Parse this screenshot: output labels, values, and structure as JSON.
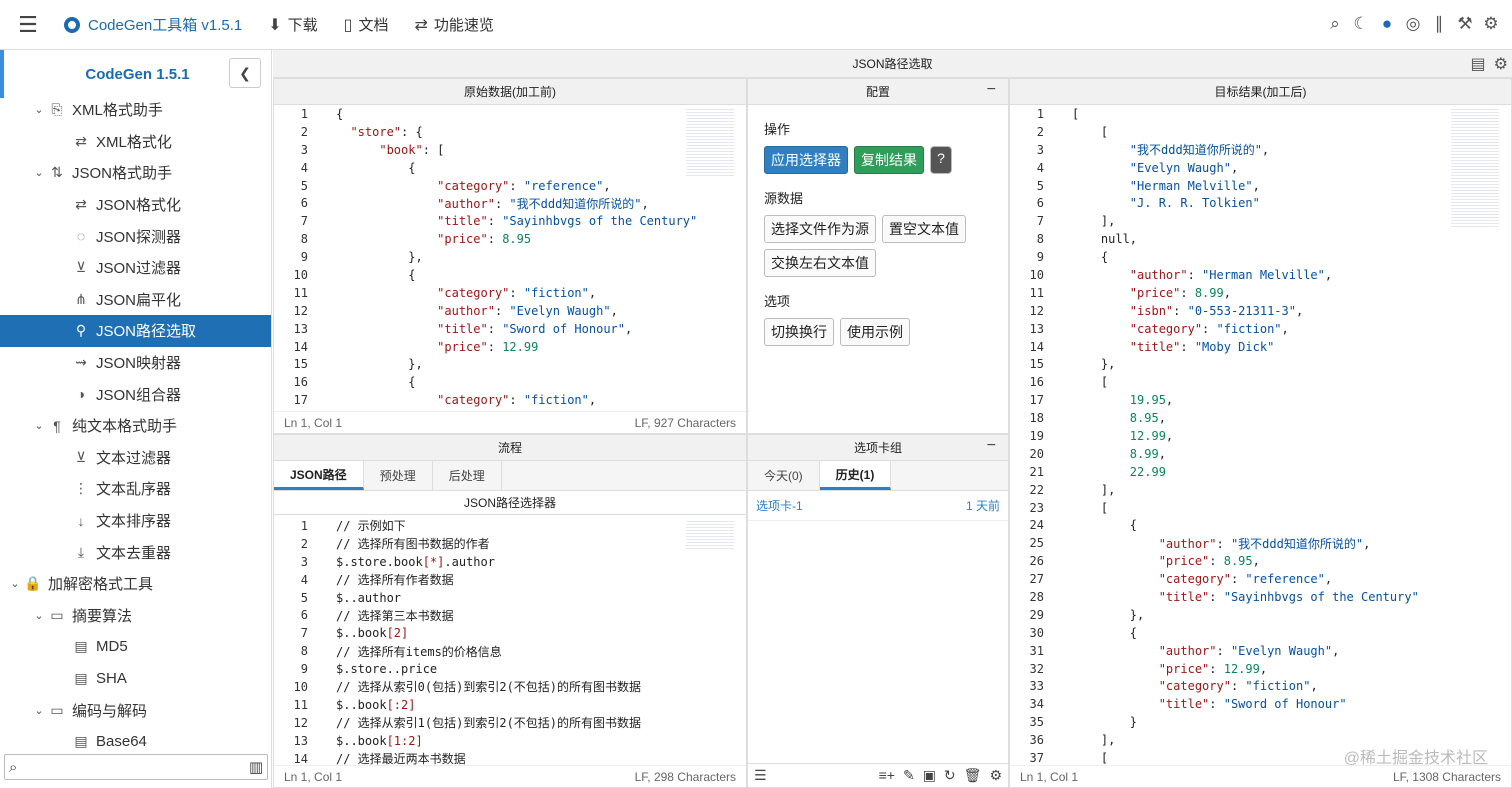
{
  "header": {
    "brand": "CodeGen工具箱 v1.5.1",
    "nav": [
      {
        "label": "下载",
        "icon": "download-icon"
      },
      {
        "label": "文档",
        "icon": "book-icon"
      },
      {
        "label": "功能速览",
        "icon": "swap-icon"
      }
    ]
  },
  "sidebar": {
    "title": "CodeGen 1.5.1",
    "items": [
      {
        "label": "XML格式助手",
        "level": 1,
        "arrow": "⌄"
      },
      {
        "label": "XML格式化",
        "level": 2
      },
      {
        "label": "JSON格式助手",
        "level": 1,
        "arrow": "⌄"
      },
      {
        "label": "JSON格式化",
        "level": 2
      },
      {
        "label": "JSON探测器",
        "level": 2
      },
      {
        "label": "JSON过滤器",
        "level": 2
      },
      {
        "label": "JSON扁平化",
        "level": 2
      },
      {
        "label": "JSON路径选取",
        "level": 2,
        "selected": true
      },
      {
        "label": "JSON映射器",
        "level": 2
      },
      {
        "label": "JSON组合器",
        "level": 2
      },
      {
        "label": "纯文本格式助手",
        "level": 1,
        "arrow": "⌄"
      },
      {
        "label": "文本过滤器",
        "level": 2
      },
      {
        "label": "文本乱序器",
        "level": 2
      },
      {
        "label": "文本排序器",
        "level": 2
      },
      {
        "label": "文本去重器",
        "level": 2
      },
      {
        "label": "加解密格式工具",
        "level": 0,
        "arrow": "⌄"
      },
      {
        "label": "摘要算法",
        "level": 1,
        "arrow": "⌄"
      },
      {
        "label": "MD5",
        "level": 2
      },
      {
        "label": "SHA",
        "level": 2
      },
      {
        "label": "编码与解码",
        "level": 1,
        "arrow": "⌄"
      },
      {
        "label": "Base64",
        "level": 2
      }
    ]
  },
  "main": {
    "title": "JSON路径选取",
    "source": {
      "title": "原始数据(加工前)",
      "status_left": "Ln 1, Col 1",
      "status_right": "LF, 927 Characters"
    },
    "config": {
      "title": "配置",
      "sections": [
        {
          "label": "操作"
        },
        {
          "label": "源数据"
        },
        {
          "label": "选项"
        }
      ],
      "buttons": {
        "apply": "应用选择器",
        "copy": "复制结果",
        "help": "?",
        "choose_file": "选择文件作为源",
        "clear": "置空文本值",
        "swap": "交换左右文本值",
        "wrap": "切换换行",
        "example": "使用示例"
      }
    },
    "target": {
      "title": "目标结果(加工后)",
      "status_left": "Ln 1, Col 1",
      "status_right": "LF, 1308 Characters"
    },
    "flow": {
      "title": "流程",
      "tabs": [
        "JSON路径",
        "预处理",
        "后处理"
      ],
      "subtitle": "JSON路径选择器",
      "status_left": "Ln 1, Col 1",
      "status_right": "LF, 298 Characters"
    },
    "tabgroup": {
      "title": "选项卡组",
      "tabs": [
        "今天(0)",
        "历史(1)"
      ],
      "item": "选项卡-1",
      "item_time": "1 天前"
    }
  },
  "watermark": "@稀土掘金技术社区"
}
